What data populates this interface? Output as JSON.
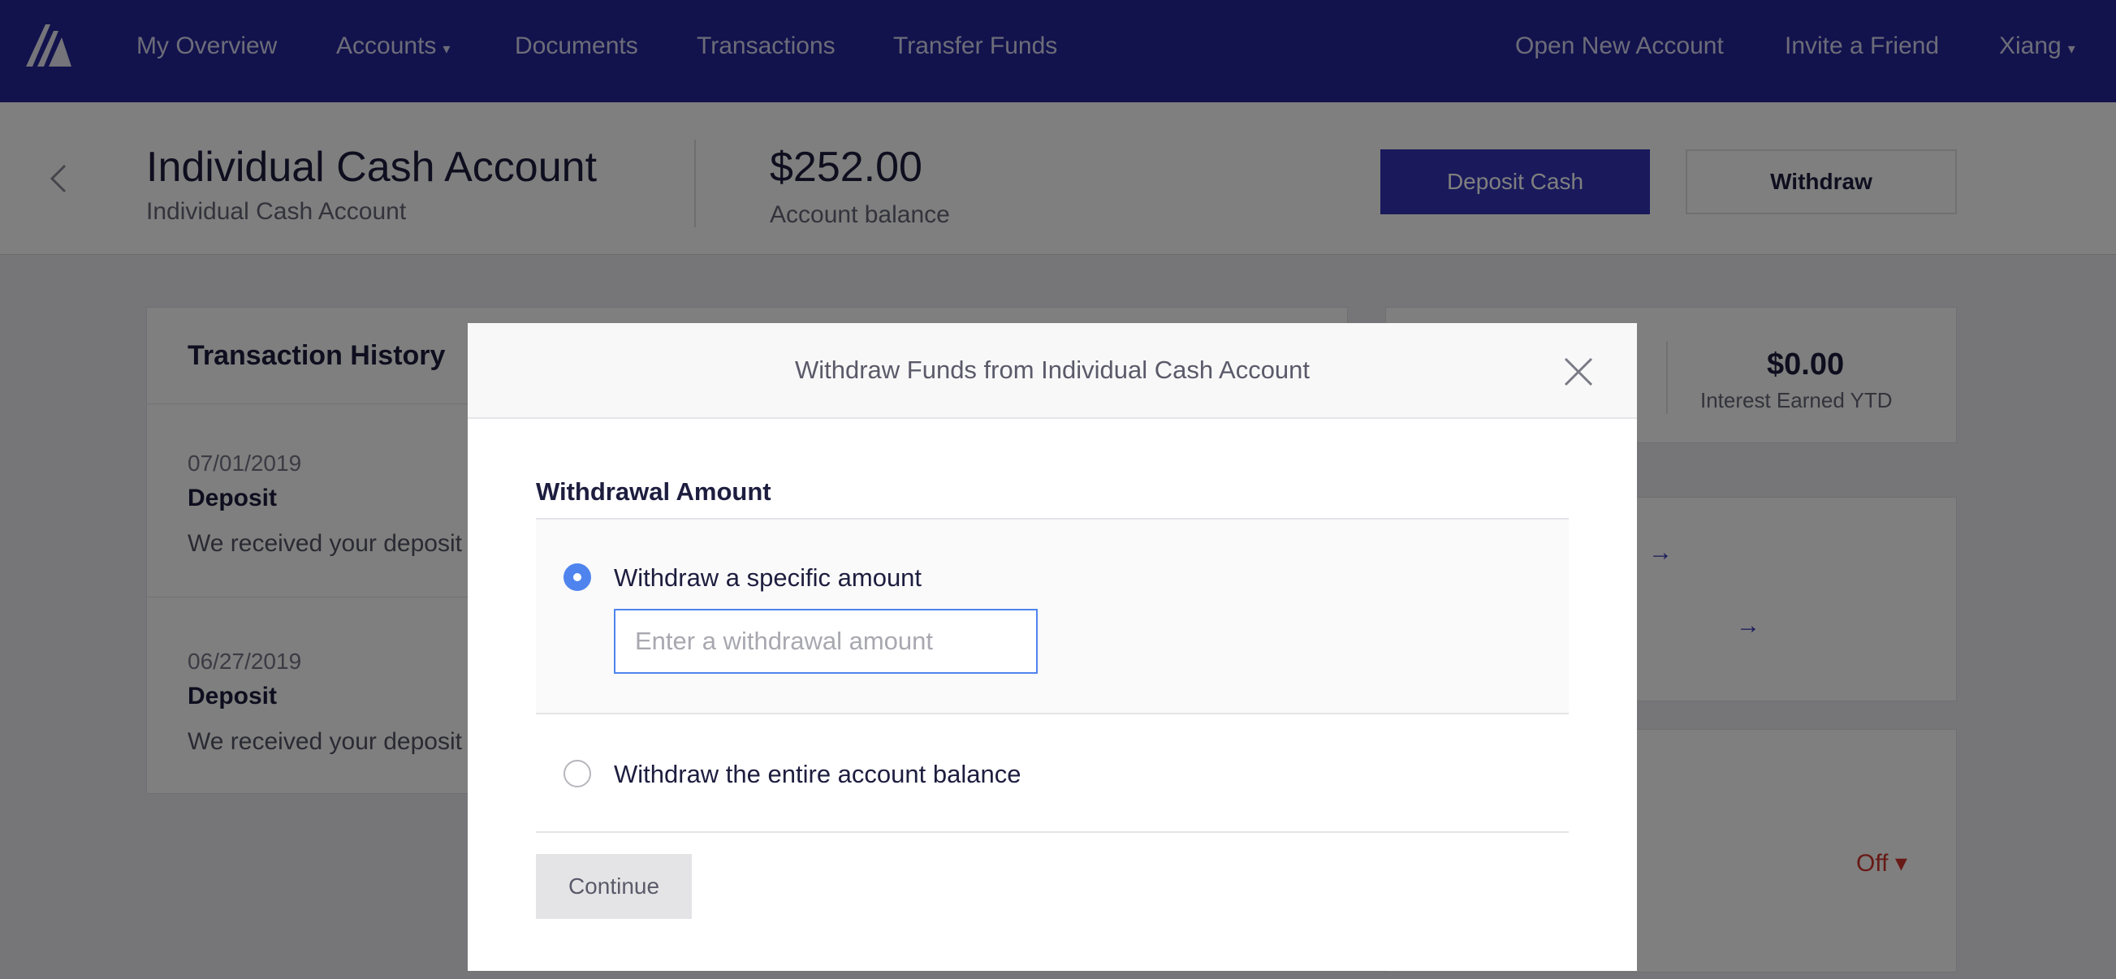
{
  "nav": {
    "left_items": [
      "My Overview",
      "Accounts",
      "Documents",
      "Transactions",
      "Transfer Funds"
    ],
    "right_items": [
      "Open New Account",
      "Invite a Friend",
      "Xiang"
    ]
  },
  "header": {
    "account_title": "Individual Cash Account",
    "account_subtitle": "Individual Cash Account",
    "balance": "$252.00",
    "balance_label": "Account balance",
    "deposit_button": "Deposit Cash",
    "withdraw_button": "Withdraw"
  },
  "transactions": {
    "title": "Transaction History",
    "items": [
      {
        "date": "07/01/2019",
        "type": "Deposit",
        "description": "We received your deposit"
      },
      {
        "date": "06/27/2019",
        "type": "Deposit",
        "description": "We received your deposit"
      }
    ]
  },
  "right_panel": {
    "interest_value": "$0.00",
    "interest_label": "Interest Earned YTD",
    "status_link": "Off"
  },
  "modal": {
    "title": "Withdraw Funds from Individual Cash Account",
    "section_title": "Withdrawal Amount",
    "option_specific": "Withdraw a specific amount",
    "amount_placeholder": "Enter a withdrawal amount",
    "amount_value": "",
    "option_entire": "Withdraw the entire account balance",
    "selected_option": "specific",
    "continue_button": "Continue"
  },
  "colors": {
    "nav_bg": "#24249b",
    "primary": "#3232b8",
    "radio_accent": "#4f84ee",
    "overlay": "rgba(0,0,0,0.5)",
    "danger": "#d0342c"
  }
}
